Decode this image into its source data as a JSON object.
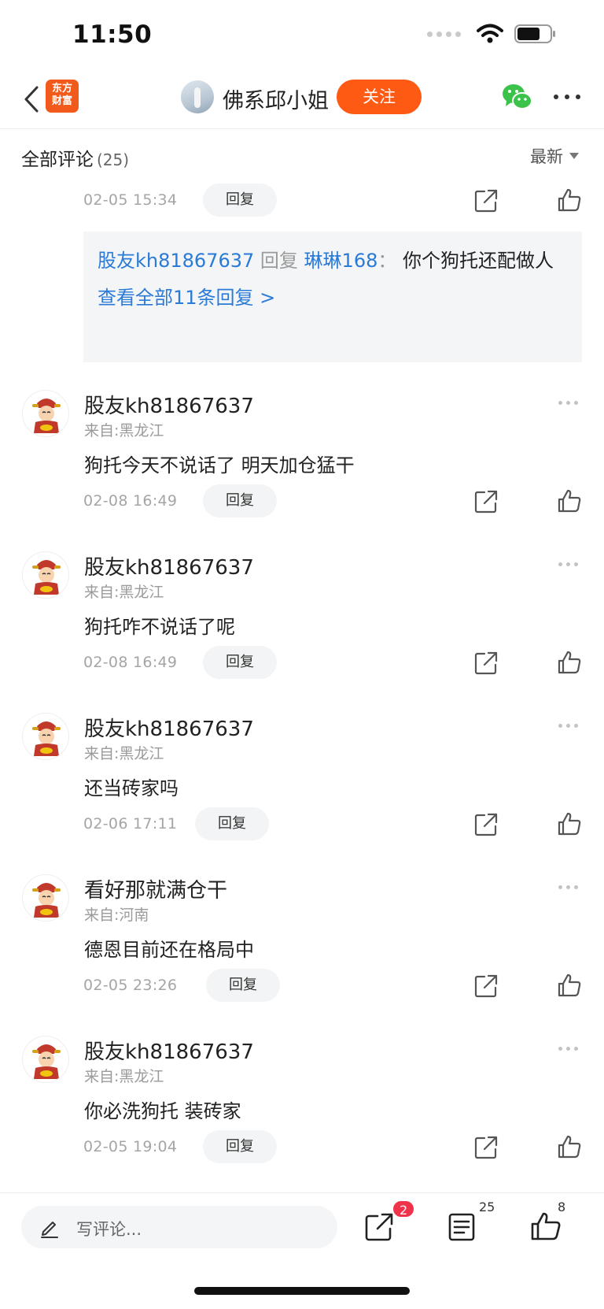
{
  "status_bar": {
    "time": "11:50"
  },
  "nav": {
    "app_logo_lines": [
      "东方",
      "财富"
    ],
    "user_name": "佛系邱小姐",
    "follow_label": "关注"
  },
  "comments_header": {
    "title": "全部评论",
    "count": "(25)",
    "sort_label": "最新"
  },
  "first_comment_meta": {
    "date": "02-05 15:34",
    "reply_label": "回复"
  },
  "reply_preview": {
    "from_user": "股友kh81867637",
    "reply_word": "回复",
    "to_user": "琳琳168",
    "colon": "：",
    "text": "你个狗托还配做人",
    "view_all": "查看全部11条回复 >"
  },
  "comments": [
    {
      "user": "股友kh81867637",
      "region": "来自:黑龙江",
      "text": "狗托今天不说话了 明天加仓猛干",
      "date": "02-08 16:49",
      "reply_label": "回复"
    },
    {
      "user": "股友kh81867637",
      "region": "来自:黑龙江",
      "text": "狗托咋不说话了呢",
      "date": "02-08 16:49",
      "reply_label": "回复"
    },
    {
      "user": "股友kh81867637",
      "region": "来自:黑龙江",
      "text": "还当砖家吗",
      "date": "02-06 17:11",
      "reply_label": "回复"
    },
    {
      "user": "看好那就满仓干",
      "region": "来自:河南",
      "text": "德恩目前还在格局中",
      "date": "02-05 23:26",
      "reply_label": "回复"
    },
    {
      "user": "股友kh81867637",
      "region": "来自:黑龙江",
      "text": "你必洗狗托 装砖家",
      "date": "02-05 19:04",
      "reply_label": "回复"
    }
  ],
  "bottom_bar": {
    "write_placeholder": "写评论...",
    "share_badge": "2",
    "comment_count": "25",
    "like_count": "8"
  },
  "colors": {
    "accent_orange": "#ff5a14",
    "link_blue": "#2a7ad7",
    "badge_red": "#f0334a"
  }
}
